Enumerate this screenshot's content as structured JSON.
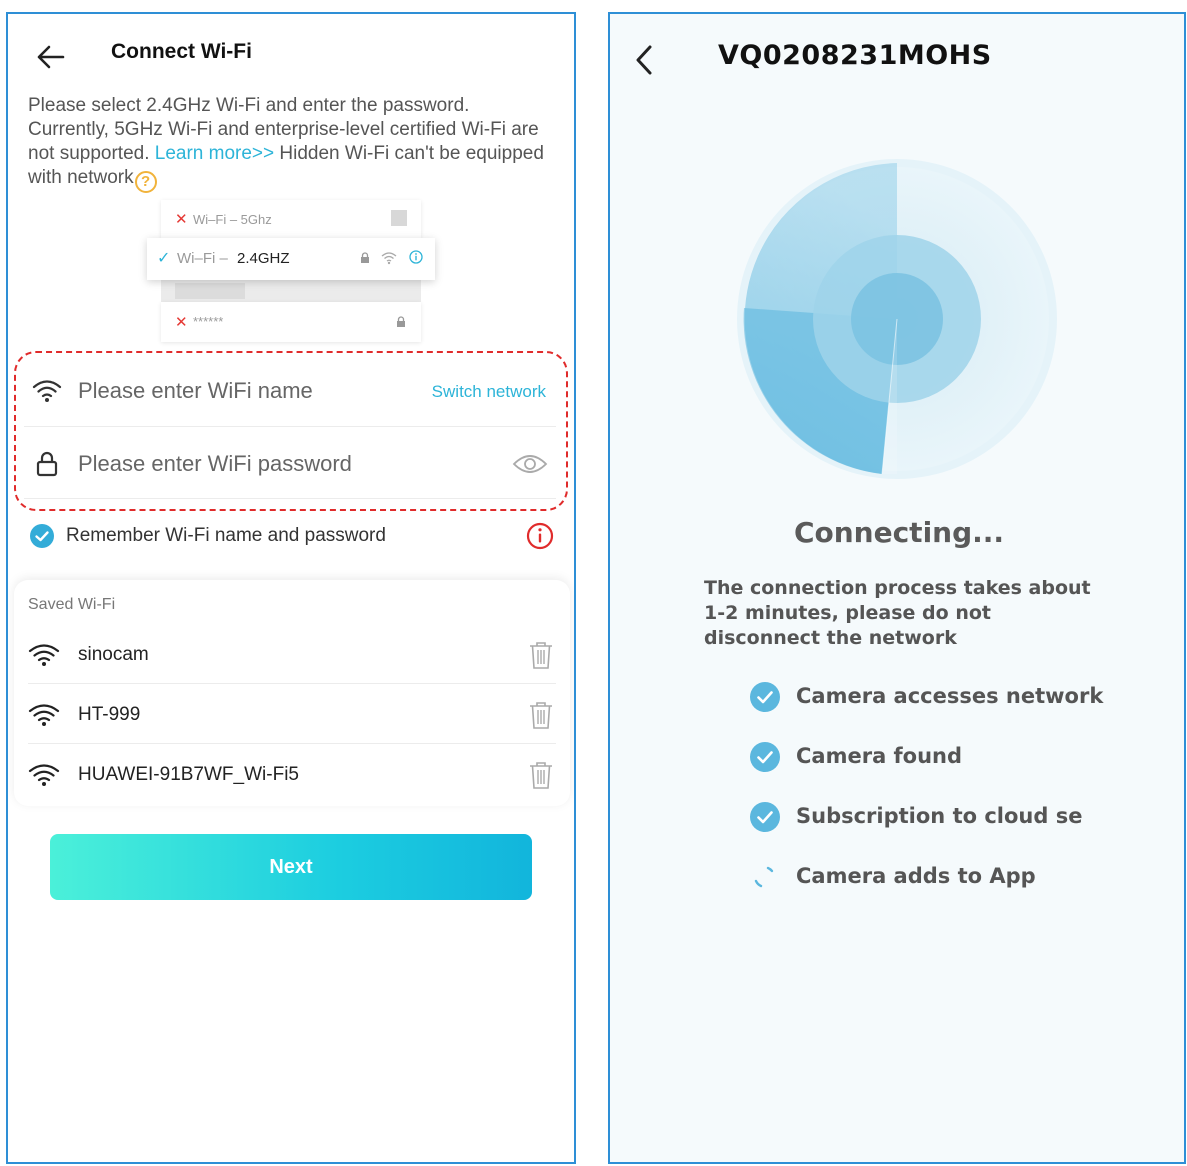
{
  "left": {
    "title": "Connect Wi-Fi",
    "description_part1": "Please select 2.4GHz Wi-Fi and enter the password. Currently, 5GHz Wi-Fi and enterprise-level certified Wi-Fi are not supported. ",
    "learn_more": "Learn more>>",
    "description_part2": " Hidden Wi-Fi can't be equipped with network",
    "illustration": {
      "row1": "Wi–Fi – 5Ghz",
      "row2_prefix": "Wi–Fi – ",
      "row2_band": "2.4GHZ",
      "row4": "******"
    },
    "wifi_name_placeholder": "Please enter WiFi name",
    "switch_network": "Switch network",
    "wifi_password_placeholder": "Please enter WiFi password",
    "remember_label": "Remember Wi-Fi name and password",
    "saved_title": "Saved Wi-Fi",
    "saved": [
      {
        "name": "sinocam"
      },
      {
        "name": "HT-999"
      },
      {
        "name": "HUAWEI-91B7WF_Wi-Fi5"
      }
    ],
    "next": "Next",
    "colors": {
      "accent": "#2db4d8",
      "warning": "#e02b2b",
      "help": "#f1b33b"
    }
  },
  "right": {
    "title": "VQ0208231MOHS",
    "status": "Connecting...",
    "description": "The connection process takes about 1-2 minutes, please do not disconnect the network",
    "steps": [
      {
        "label": "Camera accesses network",
        "state": "done"
      },
      {
        "label": "Camera found",
        "state": "done"
      },
      {
        "label": "Subscription to cloud se",
        "state": "done"
      },
      {
        "label": "Camera adds to App",
        "state": "loading"
      }
    ],
    "colors": {
      "radar": "#5bb7de",
      "check": "#5bb7de"
    }
  }
}
